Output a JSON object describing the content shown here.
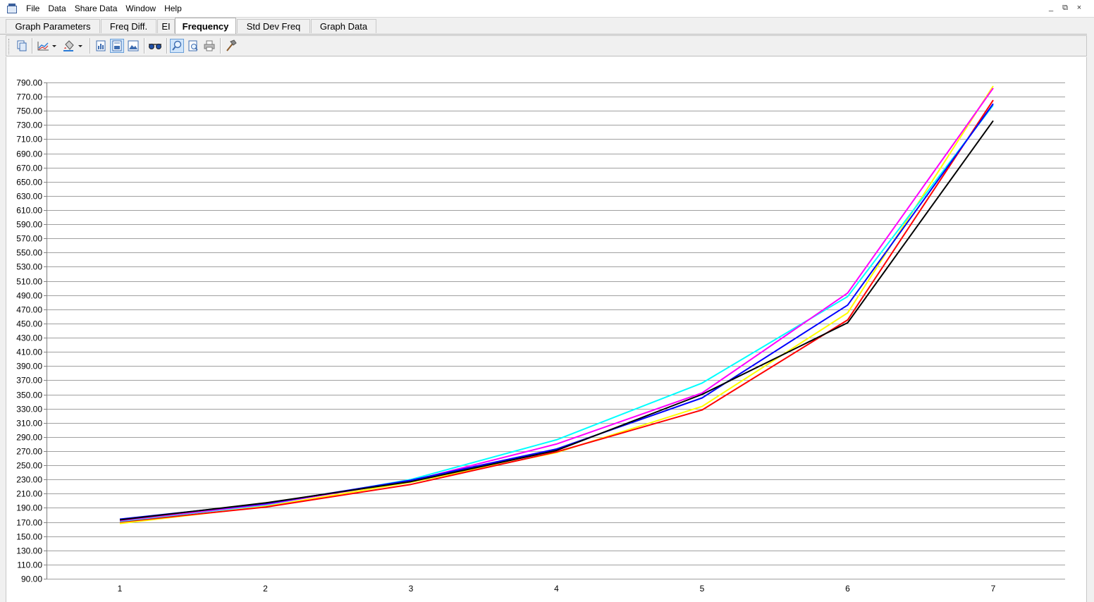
{
  "menu": {
    "items": [
      "File",
      "Data",
      "Share Data",
      "Window",
      "Help"
    ]
  },
  "window_controls": [
    "_",
    "⧉",
    "×"
  ],
  "tabs": [
    {
      "label": "Graph Parameters",
      "active": false
    },
    {
      "label": "Freq Diff.",
      "active": false
    },
    {
      "label": "EI",
      "active": false
    },
    {
      "label": "Frequency",
      "active": true
    },
    {
      "label": "Std Dev Freq",
      "active": false
    },
    {
      "label": "Graph Data",
      "active": false
    }
  ],
  "toolbar": {
    "buttons": [
      {
        "icon": "copy-icon"
      },
      {
        "icon": "chart-type-icon",
        "dropdown": true
      },
      {
        "icon": "paint-bucket-icon",
        "dropdown": true
      },
      {
        "icon": "view-data-icon"
      },
      {
        "icon": "view-table-icon",
        "pressed": true
      },
      {
        "icon": "view-image-icon"
      },
      {
        "icon": "3d-glasses-icon"
      },
      {
        "icon": "zoom-icon",
        "pressed": true
      },
      {
        "icon": "print-preview-icon"
      },
      {
        "icon": "print-icon"
      },
      {
        "icon": "tools-hammer-icon"
      }
    ]
  },
  "chart_data": {
    "type": "line",
    "title": "",
    "xlabel": "",
    "ylabel": "",
    "x": [
      1,
      2,
      3,
      4,
      5,
      6,
      7
    ],
    "x_tick_labels": [
      "1",
      "2",
      "3",
      "4",
      "5",
      "6",
      "7"
    ],
    "ylim": [
      90,
      790
    ],
    "y_tick_step": 20,
    "y_tick_format": "0.00",
    "grid": "horizontal",
    "legend": "none",
    "series": [
      {
        "color": "#ffff00",
        "values": [
          168,
          192,
          226,
          268,
          333,
          465,
          785
        ]
      },
      {
        "color": "#ff0000",
        "values": [
          170,
          191,
          223,
          269,
          328,
          455,
          765
        ]
      },
      {
        "color": "#00ffff",
        "values": [
          171,
          194,
          230,
          286,
          366,
          488,
          758
        ]
      },
      {
        "color": "#ff00ff",
        "values": [
          172,
          195,
          228,
          280,
          352,
          493,
          782
        ]
      },
      {
        "color": "#0000ff",
        "values": [
          174,
          196,
          229,
          273,
          345,
          476,
          760
        ]
      },
      {
        "color": "#000000",
        "values": [
          173,
          197,
          227,
          271,
          350,
          451,
          736
        ]
      }
    ]
  }
}
